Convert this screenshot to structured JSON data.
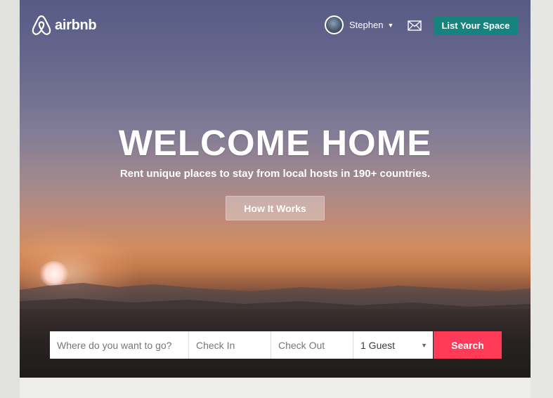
{
  "brand": {
    "name": "airbnb",
    "logo_icon": "airbnb-belo-icon"
  },
  "header": {
    "user_name": "Stephen",
    "messages_icon": "envelope-icon",
    "list_space_label": "List Your Space"
  },
  "hero": {
    "title": "WELCOME HOME",
    "subtitle": "Rent unique places to stay from local hosts in 190+ countries.",
    "how_it_works_label": "How It Works"
  },
  "search": {
    "where_placeholder": "Where do you want to go?",
    "check_in_placeholder": "Check In",
    "check_out_placeholder": "Check Out",
    "guests_value": "1 Guest",
    "search_label": "Search"
  },
  "colors": {
    "accent_teal": "#16837f",
    "search_red": "#ff3b58"
  }
}
